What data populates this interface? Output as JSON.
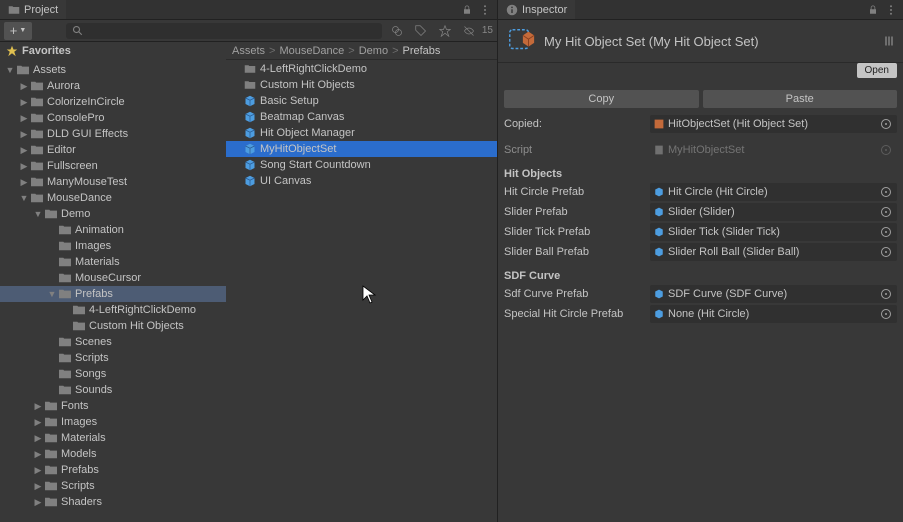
{
  "project": {
    "tab_label": "Project",
    "slider_count": "15",
    "search_placeholder": "",
    "favorites_label": "Favorites",
    "tree": [
      {
        "label": "Assets",
        "depth": 0,
        "expanded": true,
        "type": "folder",
        "selected": false
      },
      {
        "label": "Aurora",
        "depth": 1,
        "expanded": false,
        "type": "folder"
      },
      {
        "label": "ColorizeInCircle",
        "depth": 1,
        "expanded": false,
        "type": "folder"
      },
      {
        "label": "ConsolePro",
        "depth": 1,
        "expanded": false,
        "type": "folder"
      },
      {
        "label": "DLD GUI Effects",
        "depth": 1,
        "expanded": false,
        "type": "folder"
      },
      {
        "label": "Editor",
        "depth": 1,
        "expanded": false,
        "type": "folder"
      },
      {
        "label": "Fullscreen",
        "depth": 1,
        "expanded": false,
        "type": "folder"
      },
      {
        "label": "ManyMouseTest",
        "depth": 1,
        "expanded": false,
        "type": "folder"
      },
      {
        "label": "MouseDance",
        "depth": 1,
        "expanded": true,
        "type": "folder"
      },
      {
        "label": "Demo",
        "depth": 2,
        "expanded": true,
        "type": "folder"
      },
      {
        "label": "Animation",
        "depth": 3,
        "type": "folder"
      },
      {
        "label": "Images",
        "depth": 3,
        "type": "folder"
      },
      {
        "label": "Materials",
        "depth": 3,
        "type": "folder"
      },
      {
        "label": "MouseCursor",
        "depth": 3,
        "type": "folder"
      },
      {
        "label": "Prefabs",
        "depth": 3,
        "expanded": true,
        "type": "folder",
        "selected": true
      },
      {
        "label": "4-LeftRightClickDemo",
        "depth": 4,
        "type": "folder"
      },
      {
        "label": "Custom Hit Objects",
        "depth": 4,
        "type": "folder"
      },
      {
        "label": "Scenes",
        "depth": 3,
        "type": "folder"
      },
      {
        "label": "Scripts",
        "depth": 3,
        "type": "folder"
      },
      {
        "label": "Songs",
        "depth": 3,
        "type": "folder"
      },
      {
        "label": "Sounds",
        "depth": 3,
        "type": "folder"
      },
      {
        "label": "Fonts",
        "depth": 2,
        "expanded": false,
        "type": "folder"
      },
      {
        "label": "Images",
        "depth": 2,
        "expanded": false,
        "type": "folder"
      },
      {
        "label": "Materials",
        "depth": 2,
        "expanded": false,
        "type": "folder"
      },
      {
        "label": "Models",
        "depth": 2,
        "expanded": false,
        "type": "folder"
      },
      {
        "label": "Prefabs",
        "depth": 2,
        "expanded": false,
        "type": "folder"
      },
      {
        "label": "Scripts",
        "depth": 2,
        "expanded": false,
        "type": "folder"
      },
      {
        "label": "Shaders",
        "depth": 2,
        "expanded": false,
        "type": "folder"
      }
    ],
    "breadcrumbs": [
      "Assets",
      "MouseDance",
      "Demo",
      "Prefabs"
    ],
    "files": [
      {
        "label": "4-LeftRightClickDemo",
        "type": "folder"
      },
      {
        "label": "Custom Hit Objects",
        "type": "folder"
      },
      {
        "label": "Basic Setup",
        "type": "prefab"
      },
      {
        "label": "Beatmap Canvas",
        "type": "prefab"
      },
      {
        "label": "Hit Object Manager",
        "type": "prefab"
      },
      {
        "label": "MyHitObjectSet",
        "type": "prefab",
        "selected": true
      },
      {
        "label": "Song Start Countdown",
        "type": "prefab"
      },
      {
        "label": "UI Canvas",
        "type": "prefab"
      }
    ]
  },
  "inspector": {
    "tab_label": "Inspector",
    "title": "My Hit Object Set (My Hit Object Set)",
    "open_button": "Open",
    "copy_button": "Copy",
    "paste_button": "Paste",
    "copied_label": "Copied:",
    "copied_value": "HitObjectSet (Hit Object Set)",
    "script_label": "Script",
    "script_value": "MyHitObjectSet",
    "sections": {
      "hit_objects": {
        "title": "Hit Objects",
        "rows": [
          {
            "label": "Hit Circle Prefab",
            "value": "Hit Circle (Hit Circle)"
          },
          {
            "label": "Slider Prefab",
            "value": "Slider (Slider)"
          },
          {
            "label": "Slider Tick Prefab",
            "value": "Slider Tick (Slider Tick)"
          },
          {
            "label": "Slider Ball Prefab",
            "value": "Slider Roll Ball (Slider Ball)"
          }
        ]
      },
      "sdf_curve": {
        "title": "SDF Curve",
        "rows": [
          {
            "label": "Sdf Curve Prefab",
            "value": "SDF Curve (SDF Curve)"
          },
          {
            "label": "Special Hit Circle Prefab",
            "value": "None (Hit Circle)"
          }
        ]
      }
    }
  }
}
